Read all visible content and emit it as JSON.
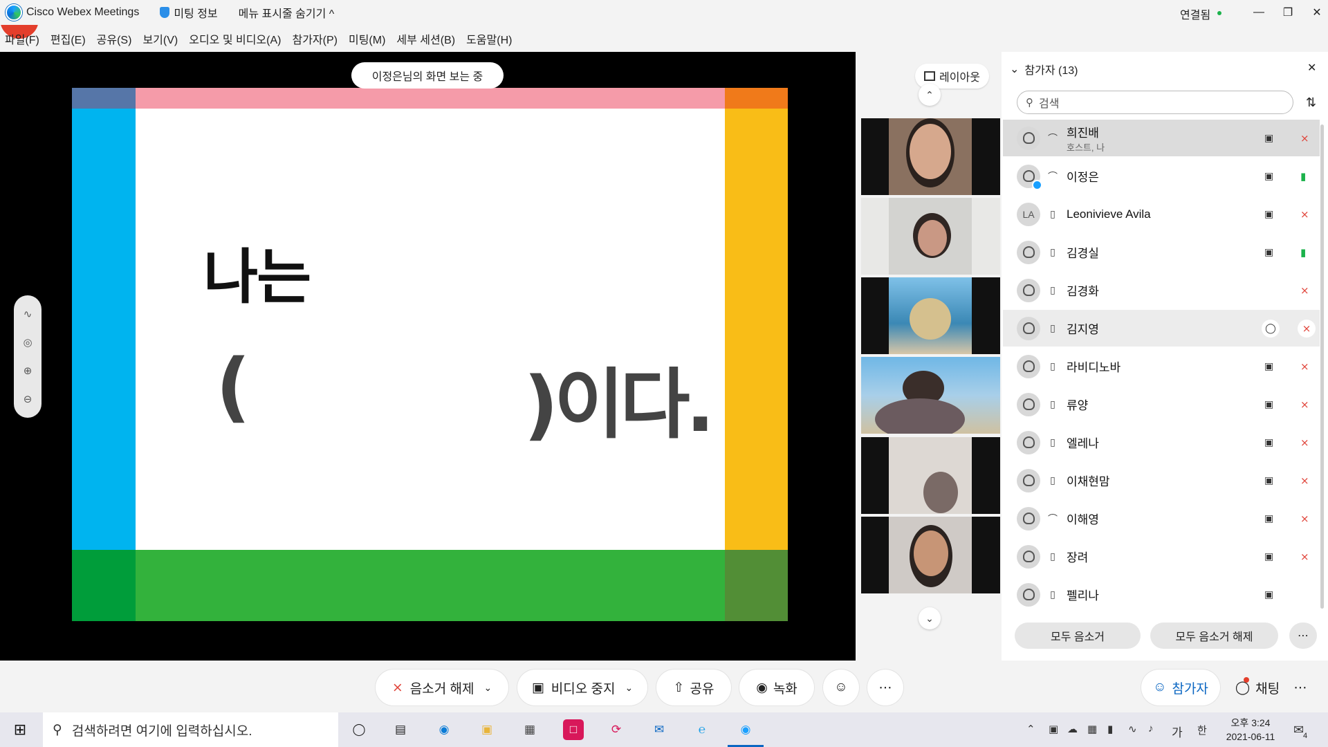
{
  "titlebar": {
    "app_name": "Cisco Webex Meetings",
    "meeting_info": "미팅 정보",
    "hide_menu": "메뉴 표시줄 숨기기 ^",
    "connection": "연결됨",
    "connection_color": "#1bb24b"
  },
  "menu": [
    "파일(F)",
    "편집(E)",
    "공유(S)",
    "보기(V)",
    "오디오 및 비디오(A)",
    "참가자(P)",
    "미팅(M)",
    "세부 세션(B)",
    "도움말(H)"
  ],
  "share_banner": "이정은님의 화면 보는 중",
  "slide": {
    "line1": "나는",
    "open_paren": "(",
    "line2": ")이다.",
    "colors": {
      "blue": "#00b4ef",
      "blue_top": "#5676a8",
      "pink": "#f59ba9",
      "orange": "#f07a1a",
      "yellow": "#f9bd17",
      "green": "#33b23c",
      "green_dark": "#009d3a",
      "green_olive": "#528e36"
    }
  },
  "layout_button": "레이아웃",
  "panel": {
    "title": "참가자 (13)",
    "search_placeholder": "검색",
    "participants": [
      {
        "name": "희진배",
        "sub": "호스트, 나",
        "avatar": "",
        "audio": "computer-audio-icon",
        "mic": "off",
        "cam": true
      },
      {
        "name": "이정은",
        "sub": "",
        "avatar": "",
        "audio": "computer-audio-icon",
        "mic": "on",
        "cam": true
      },
      {
        "name": "Leonivieve Avila",
        "sub": "",
        "avatar": "LA",
        "audio": "phone-icon",
        "mic": "off",
        "cam": true
      },
      {
        "name": "김경실",
        "sub": "",
        "avatar": "",
        "audio": "phone-icon",
        "mic": "on",
        "cam": true
      },
      {
        "name": "김경화",
        "sub": "",
        "avatar": "",
        "audio": "phone-icon",
        "mic": "off",
        "cam": false
      },
      {
        "name": "김지영",
        "sub": "",
        "avatar": "",
        "audio": "phone-icon",
        "mic": "off",
        "cam": false,
        "chat": true
      },
      {
        "name": "라비디노바",
        "sub": "",
        "avatar": "",
        "audio": "phone-icon",
        "mic": "off",
        "cam": true
      },
      {
        "name": "류양",
        "sub": "",
        "avatar": "",
        "audio": "phone-icon",
        "mic": "off",
        "cam": true
      },
      {
        "name": "엘레나",
        "sub": "",
        "avatar": "",
        "audio": "phone-icon",
        "mic": "off",
        "cam": true
      },
      {
        "name": "이채현맘",
        "sub": "",
        "avatar": "",
        "audio": "phone-icon",
        "mic": "off",
        "cam": true
      },
      {
        "name": "이해영",
        "sub": "",
        "avatar": "",
        "audio": "computer-audio-icon",
        "mic": "off",
        "cam": true
      },
      {
        "name": "장려",
        "sub": "",
        "avatar": "",
        "audio": "phone-icon",
        "mic": "off",
        "cam": true
      },
      {
        "name": "펠리나",
        "sub": "",
        "avatar": "",
        "audio": "phone-icon",
        "mic": "none",
        "cam": true
      }
    ],
    "mute_all": "모두 음소거",
    "unmute_all": "모두 음소거 해제"
  },
  "controls": {
    "unmute": "음소거 해제",
    "stop_video": "비디오 중지",
    "share": "공유",
    "record": "녹화",
    "participants": "참가자",
    "chat": "채팅"
  },
  "taskbar": {
    "search_placeholder": "검색하려면 여기에 입력하십시오.",
    "time_period": "오후 3:24",
    "date": "2021-06-11",
    "ime_lang": "가",
    "ime_mode": "한",
    "notification_count": "4"
  }
}
